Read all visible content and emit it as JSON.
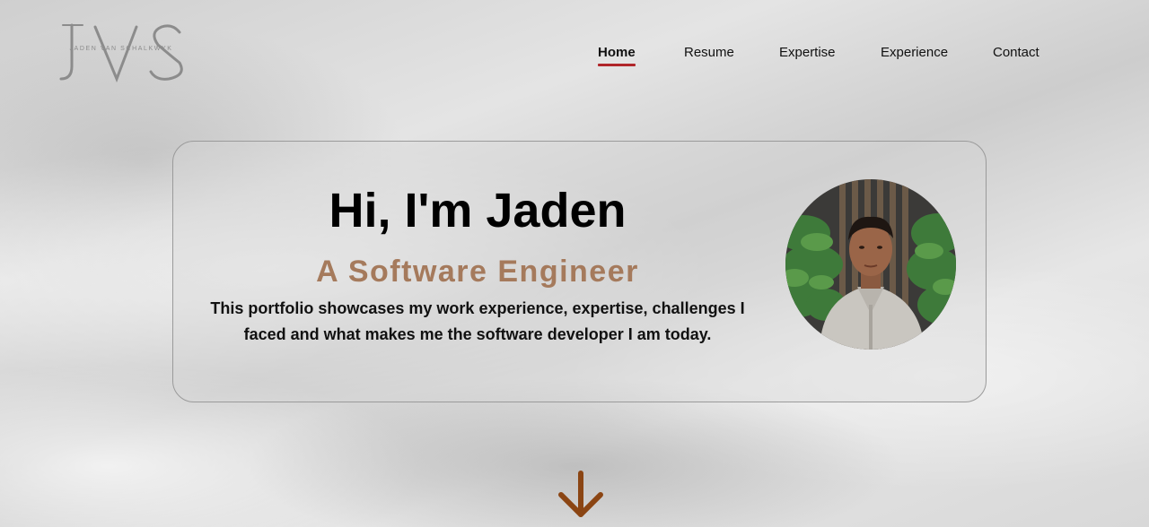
{
  "logo": {
    "monogram": "JVS",
    "name": "JADEN VAN SCHALKWYK"
  },
  "nav": {
    "items": [
      {
        "label": "Home",
        "active": true
      },
      {
        "label": "Resume",
        "active": false
      },
      {
        "label": "Expertise",
        "active": false
      },
      {
        "label": "Experience",
        "active": false
      },
      {
        "label": "Contact",
        "active": false
      }
    ]
  },
  "hero": {
    "title": "Hi, I'm Jaden",
    "subtitle": "A Software Engineer",
    "description": "This portfolio showcases my work experience, expertise, challenges I faced and what makes me the software developer I am today."
  },
  "icons": {
    "scroll": "arrow-down-icon",
    "avatar": "profile-photo"
  },
  "colors": {
    "accent": "#b0262a",
    "subtitle": "#a57a5c",
    "arrow": "#8b4513"
  }
}
